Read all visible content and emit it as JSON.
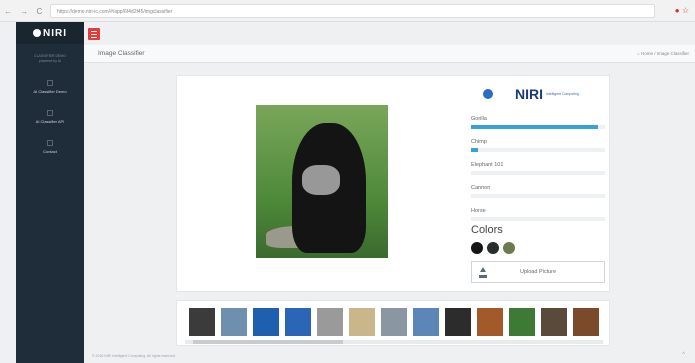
{
  "browser": {
    "nav": "← → C ⓘ",
    "url": "https://demo.niri-ic.com/#/app/6f4d2f45/imgclassifier",
    "ext": "● ☆"
  },
  "sidebar": {
    "brand": "NIRI",
    "sub": "CLASSIFIER DEMO",
    "sub2": "powered by AI",
    "items": [
      {
        "label": "AI Classifier Demo",
        "icon": "image-icon"
      },
      {
        "label": "AI Classifier API",
        "icon": "api-icon"
      },
      {
        "label": "Contact",
        "icon": "contact-icon"
      }
    ]
  },
  "header": {
    "title": "Image Classifier",
    "breadcrumb": "⌂ Home / Image Classifier"
  },
  "panel": {
    "logo_text": "NIRI",
    "logo_sub": "Intelligent Computing",
    "predictions": [
      {
        "label": "Gorilla",
        "score": 0.95
      },
      {
        "label": "Chimp",
        "score": 0.05
      },
      {
        "label": "Elephant 101",
        "score": 0.0
      },
      {
        "label": "Cannon",
        "score": 0.0
      },
      {
        "label": "Horse",
        "score": 0.0
      }
    ],
    "colors_heading": "Colors",
    "colors": [
      "#141414",
      "#2a2e2a",
      "#6b7a4f"
    ],
    "upload_label": "Upload Picture"
  },
  "thumbnails": [
    "#3b3b3b",
    "#6f8fae",
    "#1f5fb0",
    "#2a66b5",
    "#9a9a9a",
    "#c9b68a",
    "#8a96a2",
    "#5d86b8",
    "#2c2c2c",
    "#a35a2a",
    "#3d7a35",
    "#5a4a3a",
    "#7a4a2a"
  ],
  "footer": "© 2018 NIRI Intelligent Computing. All rights reserved.",
  "accent": "#e63b3b",
  "bar_color": "#3aa1d8"
}
